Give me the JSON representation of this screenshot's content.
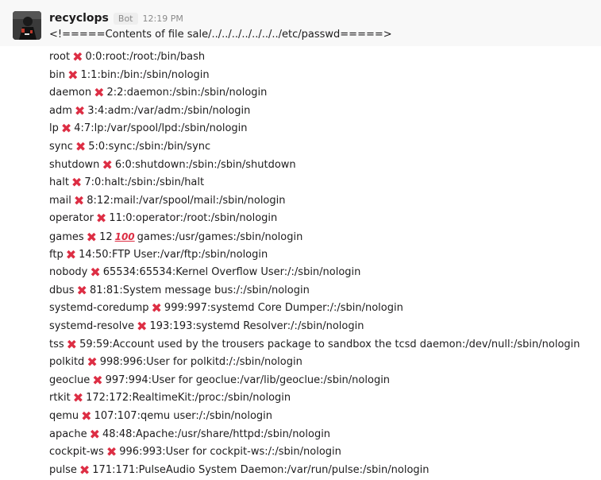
{
  "message": {
    "username": "recyclops",
    "badge": "Bot",
    "timestamp": "12:19 PM",
    "header_line": "<!=====Contents of file sale/../../../../../../../etc/passwd=====>"
  },
  "icons": {
    "cross": "✖",
    "hundred": "💯"
  },
  "lines": [
    {
      "pre": "root",
      "post": "0:0:root:/root:/bin/bash"
    },
    {
      "pre": "bin",
      "post": "1:1:bin:/bin:/sbin/nologin"
    },
    {
      "pre": "daemon",
      "post": "2:2:daemon:/sbin:/sbin/nologin"
    },
    {
      "pre": "adm",
      "post": "3:4:adm:/var/adm:/sbin/nologin"
    },
    {
      "pre": "lp",
      "post": "4:7:lp:/var/spool/lpd:/sbin/nologin"
    },
    {
      "pre": "sync",
      "post": "5:0:sync:/sbin:/bin/sync"
    },
    {
      "pre": "shutdown",
      "post": "6:0:shutdown:/sbin:/sbin/shutdown"
    },
    {
      "pre": "halt",
      "post": "7:0:halt:/sbin:/sbin/halt"
    },
    {
      "pre": "mail",
      "post": "8:12:mail:/var/spool/mail:/sbin/nologin"
    },
    {
      "pre": "operator",
      "post": "11:0:operator:/root:/sbin/nologin"
    },
    {
      "pre": "games",
      "mid": "12",
      "post": "games:/usr/games:/sbin/nologin"
    },
    {
      "pre": "ftp",
      "post": "14:50:FTP User:/var/ftp:/sbin/nologin"
    },
    {
      "pre": "nobody",
      "post": "65534:65534:Kernel Overflow User:/:/sbin/nologin"
    },
    {
      "pre": "dbus",
      "post": "81:81:System message bus:/:/sbin/nologin"
    },
    {
      "pre": "systemd-coredump",
      "post": "999:997:systemd Core Dumper:/:/sbin/nologin"
    },
    {
      "pre": "systemd-resolve",
      "post": "193:193:systemd Resolver:/:/sbin/nologin"
    },
    {
      "pre": "tss",
      "post": "59:59:Account used by the trousers package to sandbox the tcsd daemon:/dev/null:/sbin/nologin"
    },
    {
      "pre": "polkitd",
      "post": "998:996:User for polkitd:/:/sbin/nologin"
    },
    {
      "pre": "geoclue",
      "post": "997:994:User for geoclue:/var/lib/geoclue:/sbin/nologin"
    },
    {
      "pre": "rtkit",
      "post": "172:172:RealtimeKit:/proc:/sbin/nologin"
    },
    {
      "pre": "qemu",
      "post": "107:107:qemu user:/:/sbin/nologin"
    },
    {
      "pre": "apache",
      "post": "48:48:Apache:/usr/share/httpd:/sbin/nologin"
    },
    {
      "pre": "cockpit-ws",
      "post": "996:993:User for cockpit-ws:/:/sbin/nologin"
    },
    {
      "pre": "pulse",
      "post": "171:171:PulseAudio System Daemon:/var/run/pulse:/sbin/nologin"
    }
  ]
}
